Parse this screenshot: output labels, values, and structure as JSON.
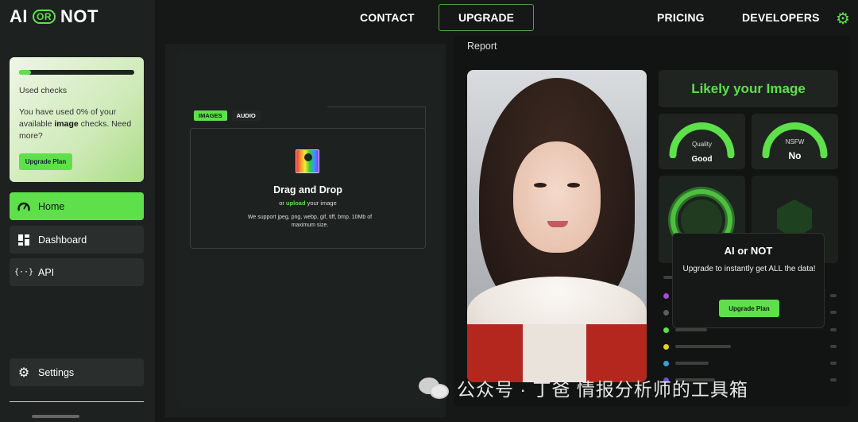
{
  "brand": {
    "logo_left": "AI",
    "logo_or": "OR",
    "logo_right": "NOT"
  },
  "topnav": {
    "contact": "CONTACT",
    "upgrade": "UPGRADE",
    "pricing": "PRICING",
    "developers": "DEVELOPERS",
    "settings_icon": "gear-icon"
  },
  "sidebar": {
    "usage": {
      "title": "Used checks",
      "desc_pre": "You have used 0% of your available ",
      "desc_bold": "image",
      "desc_post": " checks. Need more?",
      "used_fraction": 0.1,
      "button": "Upgrade Plan"
    },
    "items": [
      {
        "label": "Home",
        "icon": "gauge-icon",
        "active": true
      },
      {
        "label": "Dashboard",
        "icon": "dashboard-icon",
        "active": false
      },
      {
        "label": "API",
        "icon": "code-braces-icon",
        "active": false
      }
    ],
    "settings": {
      "label": "Settings",
      "icon": "gear-icon"
    }
  },
  "upload": {
    "tabs": [
      "IMAGES",
      "AUDIO"
    ],
    "selected_tab": "IMAGES",
    "title": "Drag and Drop",
    "sub_pre": "or ",
    "sub_link": "upload",
    "sub_post": " your image",
    "support": "We support jpeg, png, webp, gif, tiff, bmp. 10Mb of maximum size."
  },
  "report": {
    "label": "Report",
    "verdict": "Likely your Image",
    "quality": {
      "label": "Quality",
      "value": "Good"
    },
    "nsfw": {
      "label": "NSFW",
      "value": "No"
    }
  },
  "overlay": {
    "title": "AI or NOT",
    "desc": "Upgrade to instantly get ALL the data!",
    "button": "Upgrade Plan"
  },
  "watermark": {
    "text": "公众号 · 丁爸 情报分析师的工具箱"
  },
  "colors": {
    "accent": "#5ee04b",
    "background": "#151816",
    "panel": "#1d211f"
  }
}
